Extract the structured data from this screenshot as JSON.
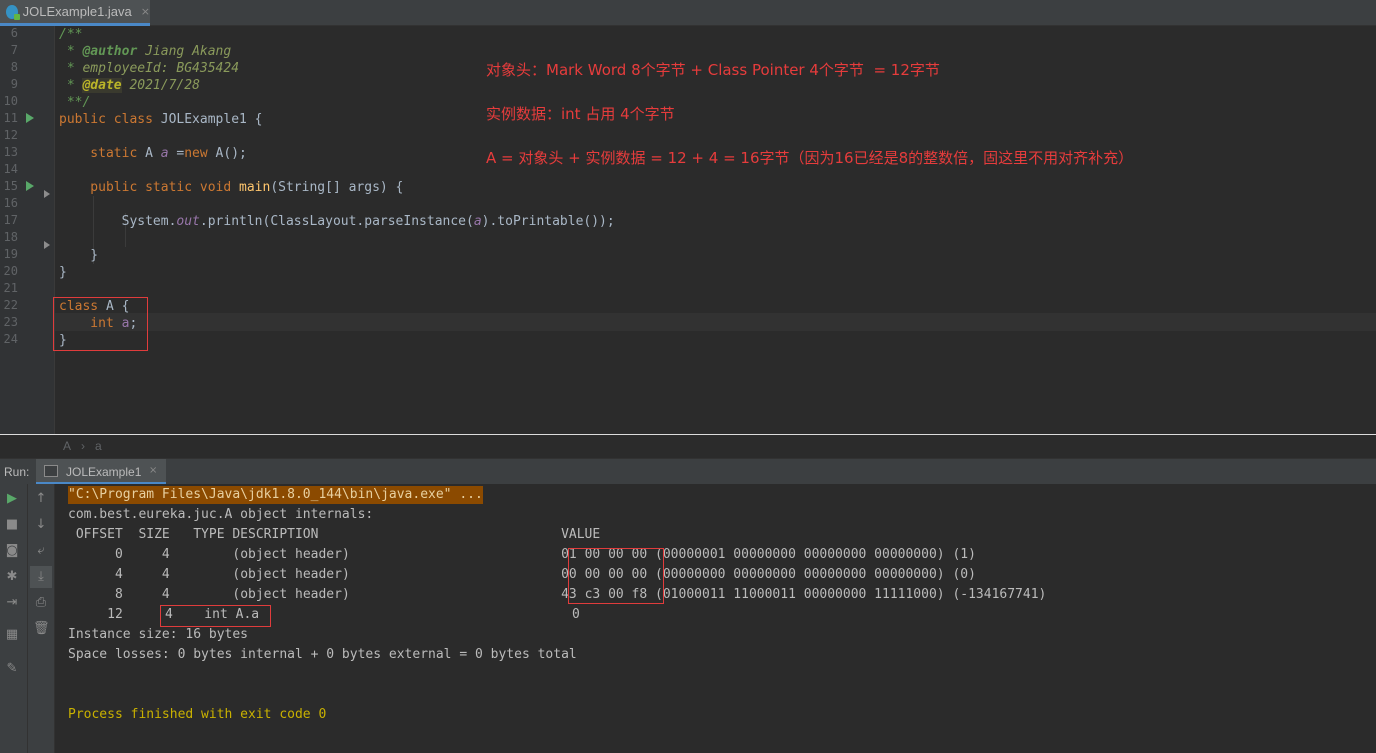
{
  "tab": {
    "title": "JOLExample1.java",
    "close": "×"
  },
  "editor": {
    "line_numbers": [
      "6",
      "7",
      "8",
      "9",
      "10",
      "11",
      "12",
      "13",
      "14",
      "15",
      "16",
      "17",
      "18",
      "19",
      "20",
      "21",
      "22",
      "23",
      "24"
    ],
    "lines": {
      "l6": "/**",
      "l7_a": " * ",
      "l7_tag": "@author",
      "l7_val": " Jiang Akang",
      "l8_a": " * ",
      "l8_b": "employeeId: BG435424",
      "l9_a": " * ",
      "l9_tag": "@date",
      "l9_val": " 2021/7/28",
      "l10": " **/",
      "l11_kw": "public class ",
      "l11_name": "JOLExample1",
      "l11_rest": " {",
      "l13_kw": "    static ",
      "l13_type": "A ",
      "l13_field": "a",
      "l13_rest": " =",
      "l13_new": "new ",
      "l13_call": "A();",
      "l15_kw": "    public static void ",
      "l15_method": "main",
      "l15_rest": "(String[] args) {",
      "l17_sys": "        System.",
      "l17_out": "out",
      "l17_println": ".println(ClassLayout.parseInstance(",
      "l17_arg": "a",
      "l17_end": ").toPrintable());",
      "l19": "    }",
      "l20": "}",
      "l22_kw": "class ",
      "l22_name": "A",
      "l22_rest": " {",
      "l23_kw": "    int ",
      "l23_field": "a",
      "l23_rest": ";",
      "l24": "}"
    }
  },
  "notes": {
    "n1": "对象头：Mark Word 8个字节 + Class Pointer 4个字节  = 12字节",
    "n2": "实例数据：int 占用 4个字节",
    "n3": "A = 对象头 + 实例数据 = 12 + 4 = 16字节（因为16已经是8的整数倍，固这里不用对齐补充）"
  },
  "breadcrumb": {
    "a": "A",
    "sep": "›",
    "b": "a"
  },
  "run": {
    "label": "Run:",
    "tab": "JOLExample1",
    "close": "×",
    "console": {
      "cmd": "\"C:\\Program Files\\Java\\jdk1.8.0_144\\bin\\java.exe\" ...",
      "header": "com.best.eureka.juc.A object internals:",
      "columns": " OFFSET  SIZE   TYPE DESCRIPTION                               VALUE",
      "rows": [
        {
          "offset": "      0",
          "size": "     4",
          "desc": "        (object header)                           ",
          "hex": "01 00 00 00",
          "bin": " (00000001 00000000 00000000 00000000) (1)"
        },
        {
          "offset": "      4",
          "size": "     4",
          "desc": "        (object header)                           ",
          "hex": "00 00 00 00",
          "bin": " (00000000 00000000 00000000 00000000) (0)"
        },
        {
          "offset": "      8",
          "size": "     4",
          "desc": "        (object header)                           ",
          "hex": "43 c3 00 f8",
          "bin": " (01000011 11000011 00000000 11111000) (-134167741)"
        }
      ],
      "row12_offset": "     12",
      "row12_size": "4",
      "row12_type": "    int A.a",
      "row12_value": "0",
      "instance_size": "Instance size: 16 bytes",
      "space_losses": "Space losses: 0 bytes internal + 0 bytes external = 0 bytes total",
      "process": "Process finished with exit code 0"
    }
  },
  "colors": {
    "accent": "#4a88c7",
    "annotation_red": "#e63c3c",
    "keyword": "#cc7832",
    "comment": "#629755"
  }
}
